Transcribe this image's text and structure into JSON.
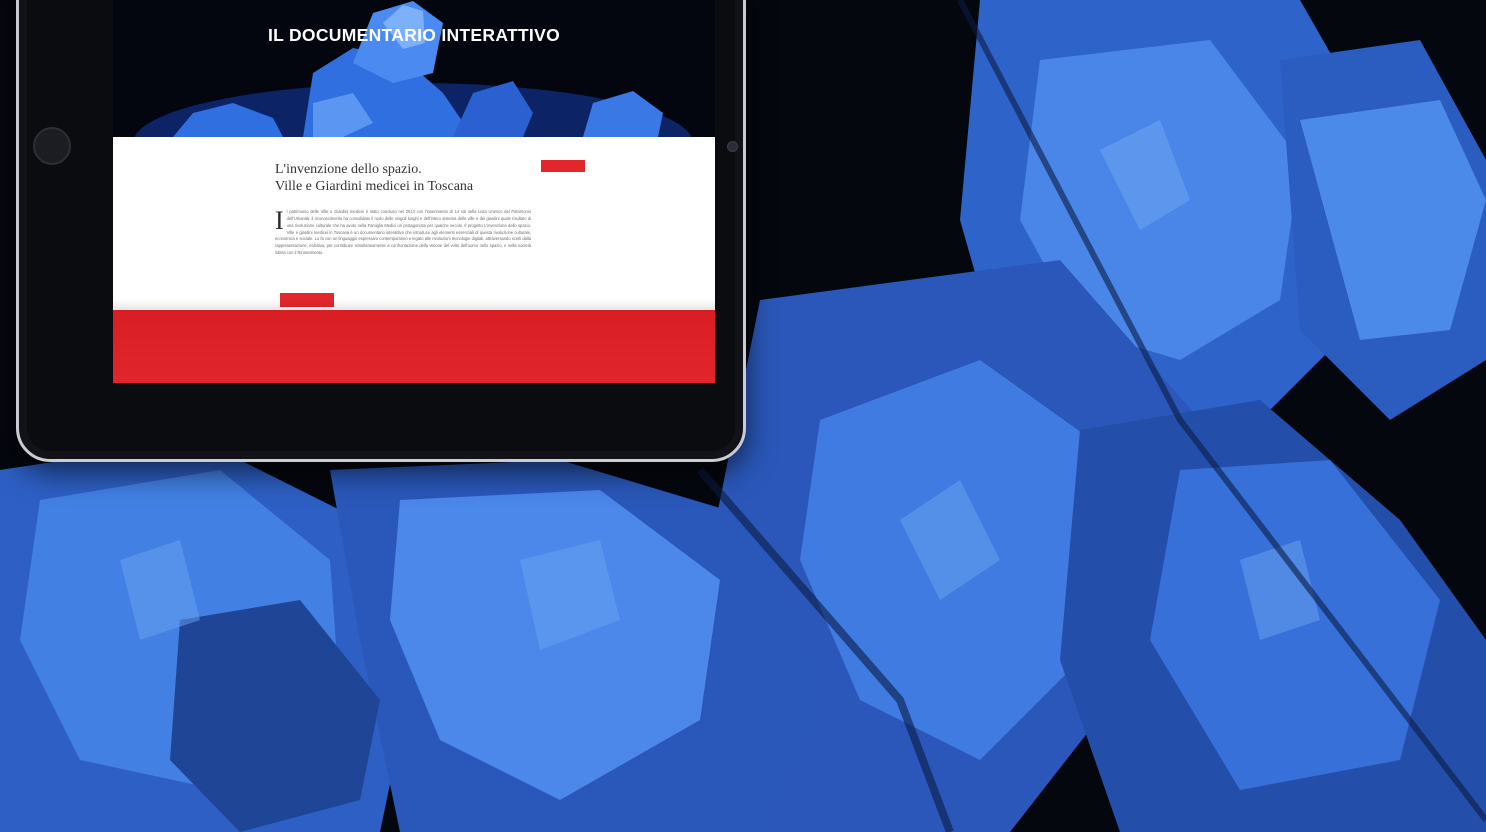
{
  "hero": {
    "title": "IL DOCUMENTARIO INTERATTIVO"
  },
  "article": {
    "title_line1": "L'invenzione dello spazio.",
    "title_line2": "Ville e Giardini medicei in Toscana",
    "top_button_label": "",
    "dropcap": "I",
    "body": "l patrimonio delle Ville e Giardini medicei è stato concluso nel 2013 con l'inserimento di 14 siti nella Lista Unesco del Patrimonio dell'Umanità: il riconoscimento ha consolidato il ruolo delle singoli luoghi e dell'intero sistema delle ville e dei giardini quale risultato di una rivoluzione culturale che ha avuto nella Famiglia Medici un protagonista per qualche secolo. Il progetto L'invenzione dello spazio. Ville e giardini medicei in Toscana è un documentario interattivo che introduce agli elementi essenziali di questa rivoluzione culturale, economica e sociale. Lo fa con un linguaggio espressivo contemporaneo e legato alle rivoluzioni tecnologie digitali, attraversando scelti dalla rappresentazione, esibitiva, per contribuire simultaneamente a confrontazione della visione del volto dell'uomo nello spazio, e nella società istinta con il Rinascimento.",
    "bottom_button_label": ""
  },
  "colors": {
    "accent": "#e3262b",
    "sculpture_blue": "#2f6fe0",
    "background": "#05070f"
  }
}
